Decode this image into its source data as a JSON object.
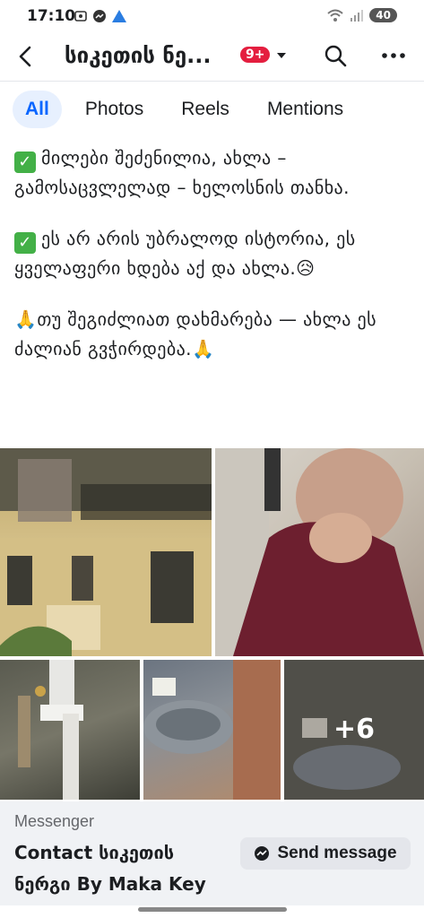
{
  "status_bar": {
    "time": "17:10",
    "battery": "40",
    "left_icons": [
      "screenshot-icon",
      "messenger-icon",
      "vpn-icon"
    ],
    "right_icons": [
      "wifi-icon",
      "signal-icon",
      "battery-icon"
    ]
  },
  "header": {
    "title": "სიკეთის ნე...",
    "notification_badge": "9+",
    "icons": [
      "back-arrow-icon",
      "chevron-down-icon",
      "search-icon",
      "more-icon"
    ]
  },
  "tabs": [
    {
      "label": "All",
      "active": true
    },
    {
      "label": "Photos",
      "active": false
    },
    {
      "label": "Reels",
      "active": false
    },
    {
      "label": "Mentions",
      "active": false
    }
  ],
  "post": {
    "para1": "მილები შეძენილია, ახლა – გამოსაცვლელად – ხელოსნის თანხა.",
    "para2": "ეს არ არის უბრალოდ ისტორია, ეს ყველაფერი  ხდება აქ და ახლა.",
    "para3_prefix": "🙏",
    "para3": "თუ შეგიძლიათ დახმარება — ახლა ეს ძალიან გვჭირდება.",
    "para3_suffix": "🙏",
    "sad_emoji": "😥",
    "check_emoji": "✓"
  },
  "photos": {
    "more_count": "+6"
  },
  "messenger_card": {
    "label": "Messenger",
    "title": "Contact სიკეთის ნერგი By Maka Key",
    "button_label": "Send message"
  },
  "colors": {
    "accent": "#0866ff",
    "badge": "#e41e3f",
    "active_tab_bg": "#e7f0fe",
    "check_green": "#43b047"
  }
}
